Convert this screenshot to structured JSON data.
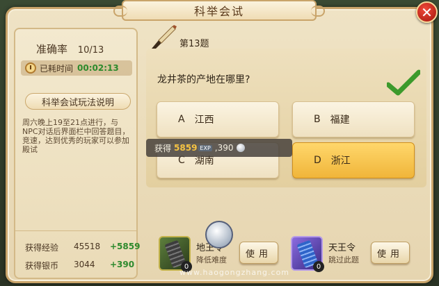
{
  "window": {
    "title": "科举会试",
    "close_symbol": "✕"
  },
  "stats": {
    "accuracy_label": "准确率",
    "accuracy_value": "10/13",
    "elapsed_label": "已耗时间",
    "elapsed_value": "00:02:13"
  },
  "rules": {
    "header": "科举会试玩法说明",
    "text": "周六晚上19至21点进行，与NPC对话后界面栏中回答题目，竞速，达到优秀的玩家可以参加殿试"
  },
  "rewards": [
    {
      "label": "获得经验",
      "value": "45518",
      "gain": "+5859"
    },
    {
      "label": "获得银币",
      "value": "3044",
      "gain": "+390"
    }
  ],
  "question": {
    "number": "第13题",
    "text": "龙井茶的产地在哪里?",
    "options": [
      {
        "letter": "A",
        "text": "江西"
      },
      {
        "letter": "B",
        "text": "福建"
      },
      {
        "letter": "C",
        "text": "湖南"
      },
      {
        "letter": "D",
        "text": "浙江"
      }
    ],
    "selected": "D"
  },
  "toast": {
    "prefix": "获得",
    "exp": "5859",
    "exp_badge": "EXP",
    "coins": ",390"
  },
  "items": [
    {
      "name": "地王令",
      "desc": "降低难度",
      "count": "0",
      "button": "使用"
    },
    {
      "name": "天王令",
      "desc": "跳过此题",
      "count": "0",
      "button": "使用"
    }
  ],
  "watermark": "www.haogongzhang.com",
  "colors": {
    "accent_green": "#2d8a2d",
    "selected_option": "#f0b53a",
    "close_red": "#c8261a"
  }
}
